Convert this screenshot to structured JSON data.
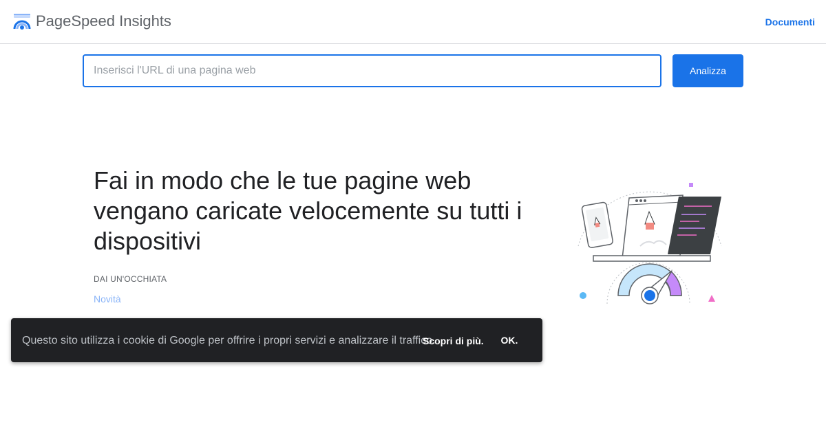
{
  "header": {
    "app_title": "PageSpeed Insights",
    "docs_link": "Documenti",
    "logo_icon": "pagespeed-logo-icon"
  },
  "search": {
    "placeholder": "Inserisci l'URL di una pagina web",
    "value": "",
    "submit_label": "Analizza"
  },
  "hero": {
    "title": "Fai in modo che le tue pagine web vengano caricate velocemente su tutti i dispositivi",
    "eyebrow": "DAI UN'OCCHIATA",
    "news_link": "Novità",
    "illustration_icon": "speed-devices-illustration"
  },
  "cookie_banner": {
    "text": "Questo sito utilizza i cookie di Google per offrire i propri servizi e analizzare il traffico.",
    "learn_more": "Scopri di più.",
    "ok_label": "OK."
  },
  "colors": {
    "accent": "#1a73e8",
    "banner_bg": "#202124",
    "link_light": "#8ab4f8"
  }
}
